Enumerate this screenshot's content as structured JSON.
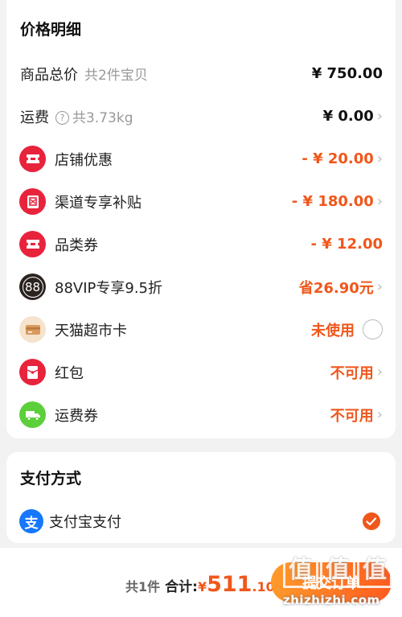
{
  "price_section": {
    "title": "价格明细",
    "rows": [
      {
        "label": "商品总价",
        "sub": "共2件宝贝",
        "value": "¥ 750.00",
        "icon": "none",
        "chevron": false
      },
      {
        "label": "运费",
        "sub": "共3.73kg",
        "value": "¥ 0.00",
        "icon": "help-icon",
        "chevron": true
      },
      {
        "label": "店铺优惠",
        "value": "- ¥ 20.00",
        "icon": "shop-coupon-icon",
        "chevron": true
      },
      {
        "label": "渠道专享补贴",
        "value": "- ¥ 180.00",
        "icon": "subsidy-icon",
        "chevron": true
      },
      {
        "label": "品类券",
        "value": "- ¥ 12.00",
        "icon": "category-coupon-icon",
        "chevron": false
      },
      {
        "label": "88VIP专享9.5折",
        "value": "省26.90元",
        "icon": "88vip-icon",
        "icon_text": "88",
        "chevron": true
      },
      {
        "label": "天猫超市卡",
        "value": "未使用",
        "icon": "card-icon",
        "chevron": false
      },
      {
        "label": "红包",
        "value": "不可用",
        "icon": "red-packet-icon",
        "chevron": true
      },
      {
        "label": "运费券",
        "value": "不可用",
        "icon": "truck-icon",
        "chevron": true
      }
    ]
  },
  "payment_section": {
    "title": "支付方式",
    "method_label": "支付宝支付",
    "method_icon": "alipay-icon",
    "alipay_glyph": "支",
    "selected": true
  },
  "footer": {
    "count_text": "共1件",
    "total_label": "合计:",
    "currency": "¥",
    "total_int": "511",
    "total_dec": ".10",
    "submit_label": "提交订单"
  },
  "watermark": {
    "logo_glyphs": [
      "值",
      "值",
      "值"
    ],
    "site_text": "zhizhizhi.com"
  },
  "colors": {
    "accent": "#f0571b",
    "coupon_red": "#e8233c",
    "vip_dark": "#2b2320",
    "card_beige": "#e8b887",
    "truck_green": "#5ccf3a"
  }
}
